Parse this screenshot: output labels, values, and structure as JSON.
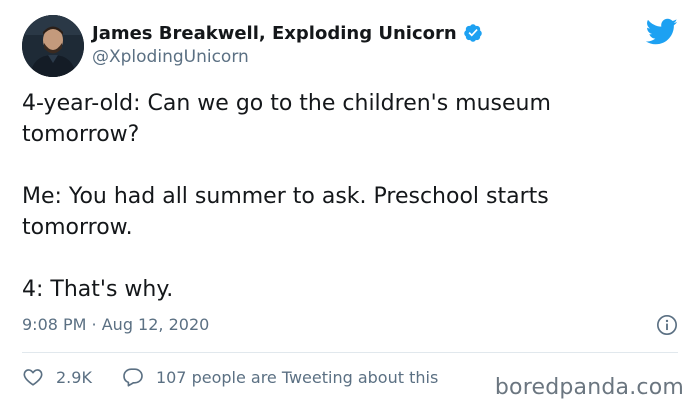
{
  "author": {
    "name": "James Breakwell, Exploding Unicorn",
    "handle": "@XplodingUnicorn"
  },
  "body": {
    "paragraphs": [
      "4-year-old: Can we go to the children's museum tomorrow?",
      "Me: You had all summer to ask. Preschool starts tomorrow.",
      "4: That's why."
    ]
  },
  "meta": {
    "timestamp": "9:08 PM · Aug 12, 2020"
  },
  "actions": {
    "likes": "2.9K",
    "discussion": "107 people are Tweeting about this"
  },
  "watermark": "boredpanda.com",
  "colors": {
    "twitter_blue": "#1da1f2",
    "secondary_text": "#5b7083",
    "primary_text": "#14171a"
  },
  "icons": [
    "verified-badge-icon",
    "twitter-bird-icon",
    "info-icon",
    "heart-icon",
    "comment-bubble-icon"
  ]
}
